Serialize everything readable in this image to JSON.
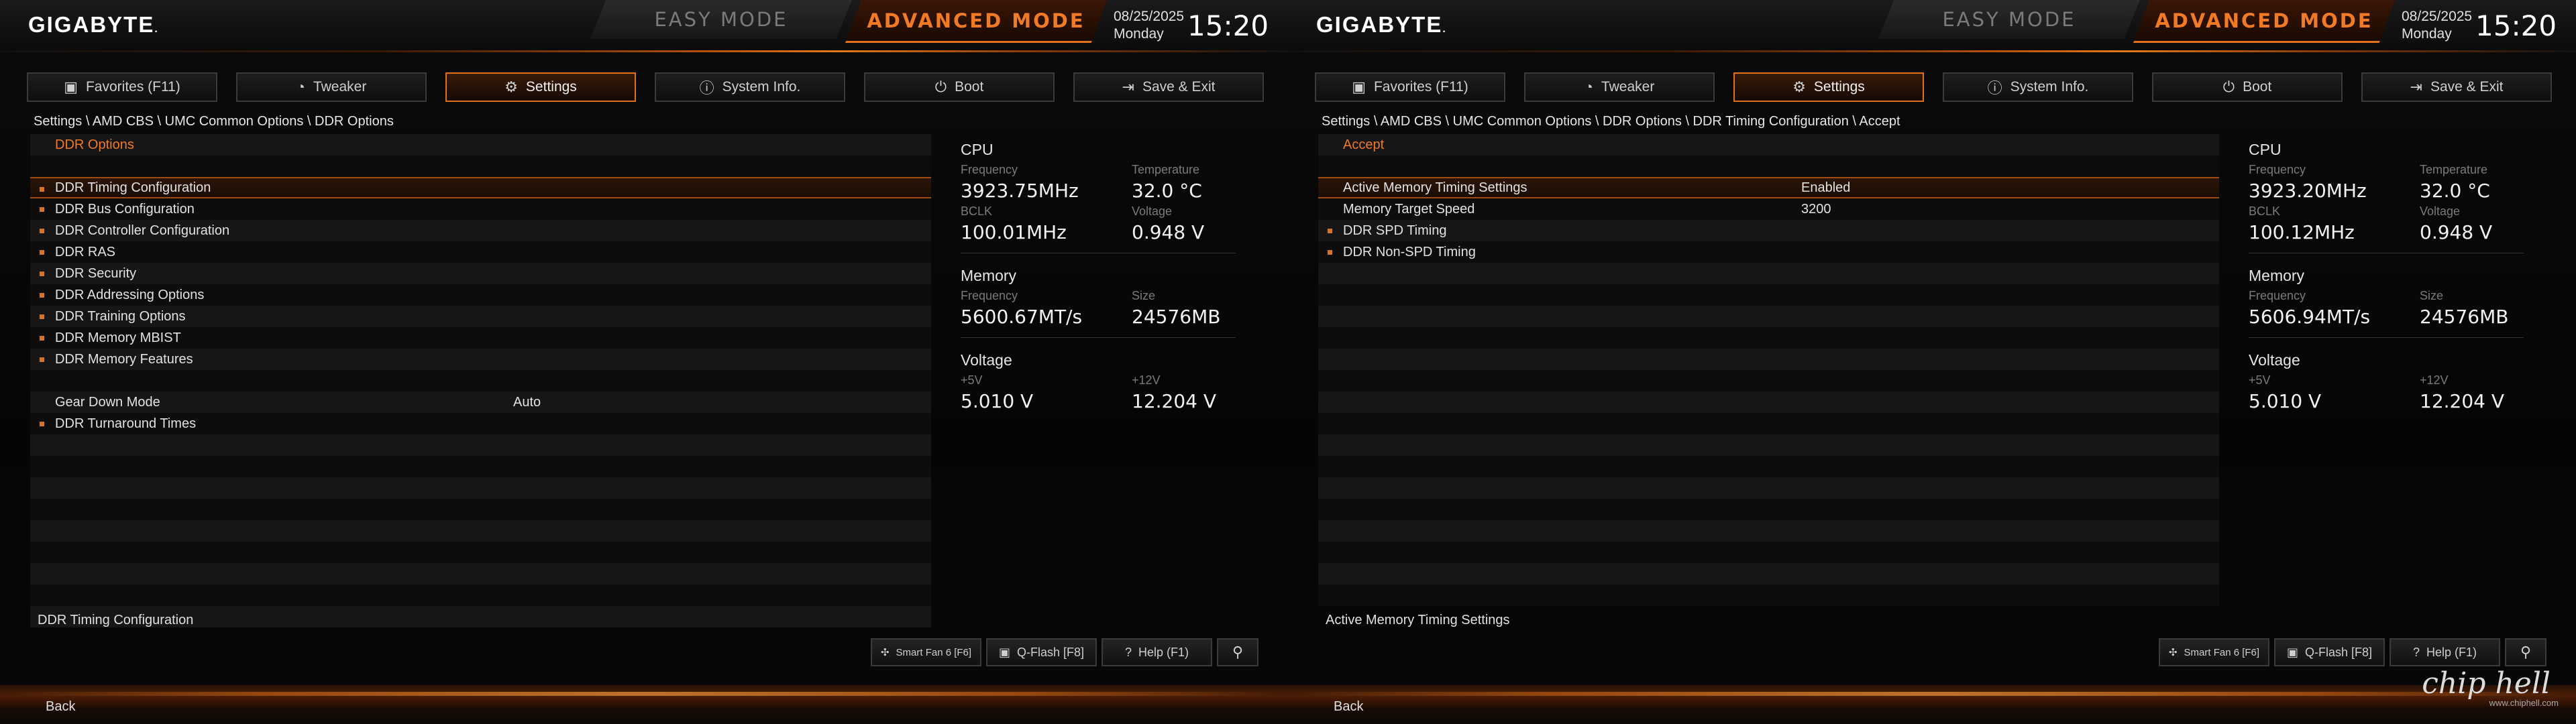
{
  "logo": "GIGABYTE",
  "modes": {
    "easy": "EASY MODE",
    "advanced": "ADVANCED MODE"
  },
  "date": "08/25/2025",
  "day": "Monday",
  "time": "15:20",
  "tabs": [
    {
      "label": "Favorites (F11)",
      "icon": "favorites-icon"
    },
    {
      "label": "Tweaker",
      "icon": "speedometer-icon"
    },
    {
      "label": "Settings",
      "icon": "gear-icon"
    },
    {
      "label": "System Info.",
      "icon": "info-icon"
    },
    {
      "label": "Boot",
      "icon": "power-icon"
    },
    {
      "label": "Save & Exit",
      "icon": "exit-icon"
    }
  ],
  "bottom": {
    "smart_fan": "Smart Fan 6 [F6]",
    "qflash": "Q-Flash [F8]",
    "help": "Help (F1)",
    "back": "Back"
  },
  "info_labels": {
    "cpu": "CPU",
    "memory": "Memory",
    "voltage": "Voltage",
    "frequency": "Frequency",
    "temperature": "Temperature",
    "bclk": "BCLK",
    "cpu_voltage": "Voltage",
    "size": "Size",
    "v5": "+5V",
    "v12": "+12V"
  },
  "left": {
    "breadcrumb": "Settings  \\  AMD CBS  \\  UMC Common Options  \\  DDR Options",
    "header": "DDR Options",
    "items": [
      "DDR Timing Configuration",
      "DDR Bus Configuration",
      "DDR Controller Configuration",
      "DDR RAS",
      "DDR Security",
      "DDR Addressing Options",
      "DDR Training Options",
      "DDR Memory MBIST",
      "DDR Memory Features"
    ],
    "gear_down_label": "Gear Down Mode",
    "gear_down_value": "Auto",
    "turnaround": "DDR Turnaround Times",
    "help": "DDR Timing Configuration",
    "cpu": {
      "freq": "3923.75MHz",
      "temp": "32.0 °C",
      "bclk": "100.01MHz",
      "volt": "0.948 V"
    },
    "mem": {
      "freq": "5600.67MT/s",
      "size": "24576MB"
    },
    "volt": {
      "v5": "5.010 V",
      "v12": "12.204 V"
    }
  },
  "right": {
    "breadcrumb": "Settings  \\  AMD CBS  \\  UMC Common Options  \\  DDR Options  \\  DDR Timing Configuration  \\  Accept",
    "header": "Accept",
    "amts_label": "Active Memory Timing Settings",
    "amts_value": "Enabled",
    "mts_label": "Memory Target Speed",
    "mts_value": "3200",
    "spd": "DDR SPD Timing",
    "nonspd": "DDR Non-SPD Timing",
    "help": "Active Memory Timing Settings",
    "cpu": {
      "freq": "3923.20MHz",
      "temp": "32.0 °C",
      "bclk": "100.12MHz",
      "volt": "0.948 V"
    },
    "mem": {
      "freq": "5606.94MT/s",
      "size": "24576MB"
    },
    "volt": {
      "v5": "5.010 V",
      "v12": "12.204 V"
    },
    "watermark": "chip hell",
    "watermark_url": "www.chiphell.com"
  }
}
